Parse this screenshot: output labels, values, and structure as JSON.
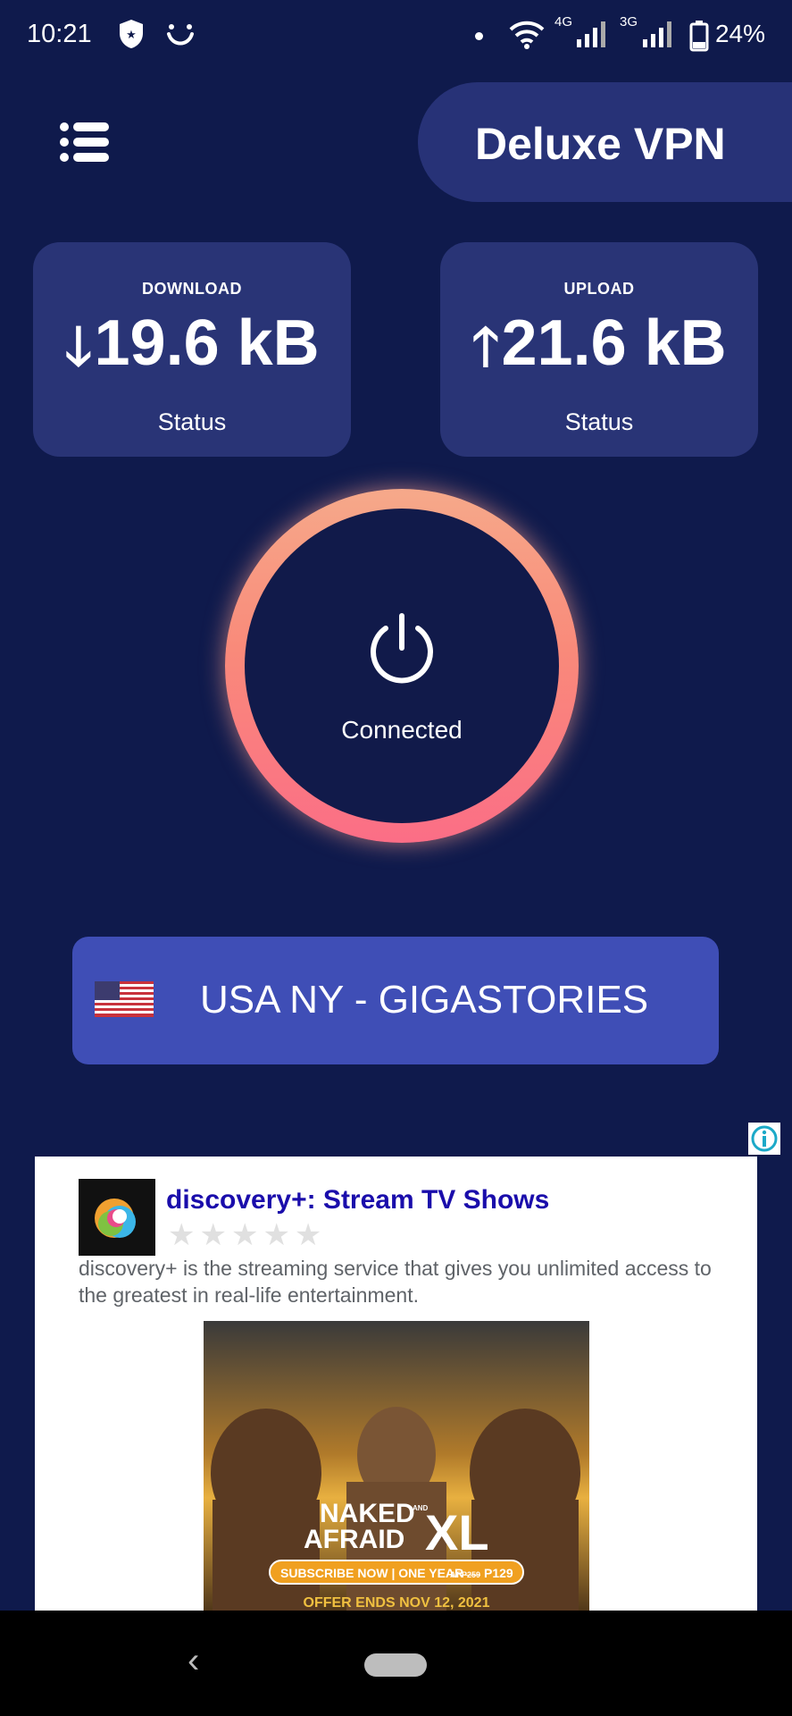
{
  "status_bar": {
    "time": "10:21",
    "network_4g": "4G",
    "network_3g": "3G",
    "battery": "24%"
  },
  "header": {
    "menu_icon": "list-menu-icon",
    "title": "Deluxe VPN"
  },
  "stats": {
    "download": {
      "label": "DOWNLOAD",
      "value": "19.6 kB",
      "status": "Status",
      "icon": "arrow-down-icon"
    },
    "upload": {
      "label": "UPLOAD",
      "value": "21.6 kB",
      "status": "Status",
      "icon": "arrow-up-icon"
    }
  },
  "power": {
    "state": "Connected",
    "icon": "power-icon",
    "ring_colors": [
      "#f6a98a",
      "#fb6e86"
    ]
  },
  "server": {
    "label": "USA NY - GIGASTORIES",
    "flag": "usa-flag-icon"
  },
  "ad": {
    "title": "discovery+: Stream TV Shows",
    "rating_stars": "★★★★★",
    "description": "discovery+ is the streaming service that gives you unlimited access to the greatest in real-life entertainment.",
    "image": {
      "show_title_1": "NAKED",
      "show_title_2": "AFRAID",
      "show_title_and": "AND",
      "show_title_xl": "XL",
      "subscribe": "SUBSCRIBE NOW | ONE YEAR",
      "price_prefix": "AT",
      "price_strike": "P259",
      "price": "P129",
      "offer": "OFFER ENDS NOV 12, 2021"
    }
  },
  "colors": {
    "background": "#0f1a4c",
    "card": "#293476",
    "server_button": "#3f4eb6",
    "ad_title": "#1a0dab"
  }
}
